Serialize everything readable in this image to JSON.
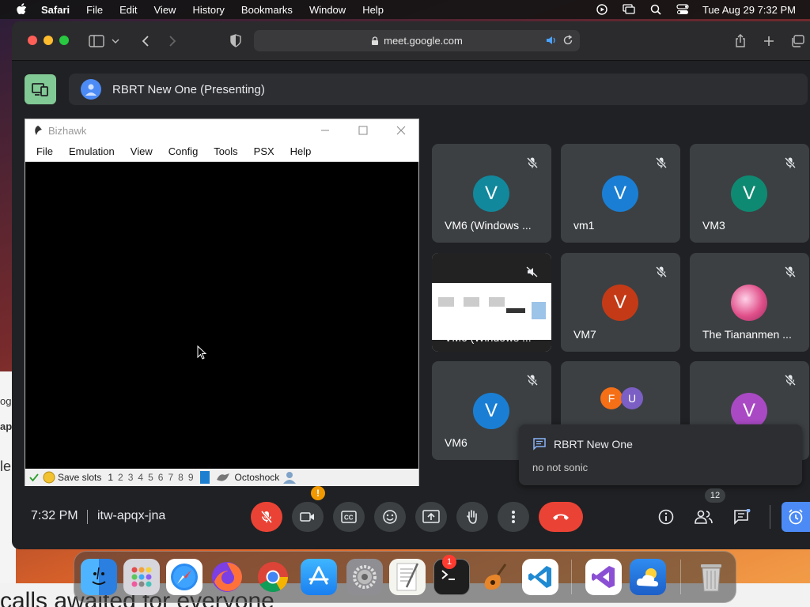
{
  "menubar": {
    "app": "Safari",
    "items": [
      "File",
      "Edit",
      "View",
      "History",
      "Bookmarks",
      "Window",
      "Help"
    ],
    "clock": "Tue Aug 29  7:32 PM"
  },
  "browser": {
    "url": "meet.google.com"
  },
  "meet": {
    "presenting_label": "RBRT New One (Presenting)",
    "bizhawk": {
      "title": "Bizhawk",
      "menu": [
        "File",
        "Emulation",
        "View",
        "Config",
        "Tools",
        "PSX",
        "Help"
      ],
      "status_label": "Save slots",
      "slots": [
        "1",
        "2",
        "3",
        "4",
        "5",
        "6",
        "7",
        "8",
        "9"
      ],
      "core": "Octoshock"
    },
    "tiles": [
      {
        "name": "VM6 (Windows ...",
        "initial": "V",
        "color": "#12889d"
      },
      {
        "name": "vm1",
        "initial": "V",
        "color": "#1a7fd4"
      },
      {
        "name": "VM3",
        "initial": "V",
        "color": "#0f8a72"
      },
      {
        "name": "VM6 (Windows ...",
        "initial": "",
        "color": "#ffffff"
      },
      {
        "name": "VM7",
        "initial": "V",
        "color": "#c43a16"
      },
      {
        "name": "The Tiananmen ...",
        "initial": "",
        "color": "#e0508a"
      },
      {
        "name": "VM6",
        "initial": "V",
        "color": "#1a7fd4"
      },
      {
        "name": "",
        "initial": "F",
        "color": "#f46f16"
      },
      {
        "name": "",
        "initial": "V",
        "color": "#a94ac4"
      }
    ],
    "extra_initial": "U",
    "chat": {
      "sender": "RBRT New One",
      "message": "no not sonic"
    },
    "bottom": {
      "time": "7:32 PM",
      "code": "itw-apqx-jna",
      "participants_count": "12"
    }
  },
  "dock": {
    "settings_badge": "1"
  },
  "background": {
    "bottom_text": "calls awaited for everyone",
    "frag1": "ogl",
    "frag2": "ap",
    "frag3": "le"
  }
}
